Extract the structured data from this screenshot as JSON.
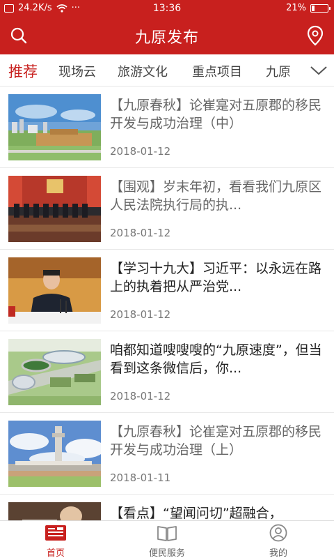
{
  "status_bar": {
    "speed": "24.2K/s",
    "time": "13:36",
    "battery": "21%",
    "battery_level": 0.21
  },
  "header": {
    "title": "九原发布"
  },
  "tabs": [
    {
      "label": "推荐"
    },
    {
      "label": "现场云"
    },
    {
      "label": "旅游文化"
    },
    {
      "label": "重点项目"
    },
    {
      "label": "九原"
    }
  ],
  "articles": [
    {
      "title": "【九原春秋】论崔寔对五原郡的移民开发与成功治理（中）",
      "date": "2018-01-12",
      "image": "city-skyline-photo"
    },
    {
      "title": "【围观】岁末年初，看看我们九原区人民法院执行局的执...",
      "date": "2018-01-12",
      "image": "meeting-hall-photo"
    },
    {
      "title": "【学习十九大】习近平：以永远在路上的执着把从严治党...",
      "date": "2018-01-12",
      "image": "speaker-photo"
    },
    {
      "title": "咱都知道嗖嗖嗖的“九原速度”，但当看到这条微信后，你...",
      "date": "2018-01-12",
      "image": "stadium-aerial-photo"
    },
    {
      "title": "【九原春秋】论崔寔对五原郡的移民开发与成功治理（上）",
      "date": "2018-01-11",
      "image": "tower-photo"
    },
    {
      "title": "【看点】“望闻问切”超融合，",
      "date": "",
      "image": "clinic-photo"
    }
  ],
  "tabbar": [
    {
      "label": "首页",
      "icon": "home-newspaper-icon"
    },
    {
      "label": "便民服务",
      "icon": "book-icon"
    },
    {
      "label": "我的",
      "icon": "user-icon"
    }
  ],
  "colors": {
    "brand": "#c8201e",
    "text": "#333333",
    "muted": "#777777"
  }
}
